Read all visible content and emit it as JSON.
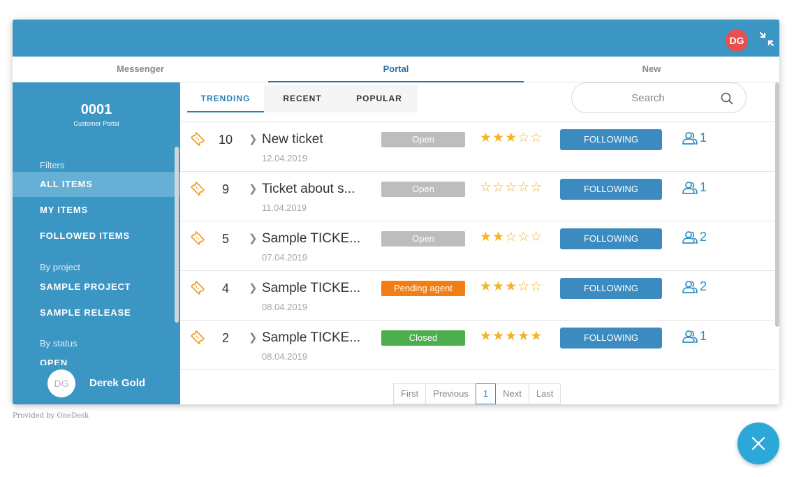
{
  "header": {
    "avatar_initials": "DG"
  },
  "tabs": [
    {
      "label": "Messenger",
      "active": false
    },
    {
      "label": "Portal",
      "active": true
    },
    {
      "label": "New",
      "active": false
    }
  ],
  "sidebar": {
    "portal_number": "0001",
    "portal_name": "Customer Portal",
    "filters_heading": "Filters",
    "items": [
      {
        "label": "ALL ITEMS",
        "active": true
      },
      {
        "label": "MY ITEMS",
        "active": false
      },
      {
        "label": "FOLLOWED ITEMS",
        "active": false
      }
    ],
    "by_project_heading": "By project",
    "projects": [
      "SAMPLE PROJECT",
      "SAMPLE RELEASE"
    ],
    "by_status_heading": "By status",
    "statuses": [
      "OPEN"
    ],
    "user": {
      "initials": "DG",
      "name": "Derek Gold"
    }
  },
  "subtabs": [
    {
      "label": "TRENDING",
      "active": true
    },
    {
      "label": "RECENT",
      "active": false
    },
    {
      "label": "POPULAR",
      "active": false
    }
  ],
  "search": {
    "placeholder": "Search"
  },
  "tickets": [
    {
      "number": "10",
      "title": "New ticket",
      "date": "12.04.2019",
      "status": "Open",
      "status_color": "#bdbdbd",
      "rating": 3,
      "follow_label": "FOLLOWING",
      "followers": "1"
    },
    {
      "number": "9",
      "title": "Ticket about s...",
      "date": "11.04.2019",
      "status": "Open",
      "status_color": "#bdbdbd",
      "rating": 0,
      "follow_label": "FOLLOWING",
      "followers": "1"
    },
    {
      "number": "5",
      "title": "Sample TICKE...",
      "date": "07.04.2019",
      "status": "Open",
      "status_color": "#bdbdbd",
      "rating": 2,
      "follow_label": "FOLLOWING",
      "followers": "2"
    },
    {
      "number": "4",
      "title": "Sample TICKE...",
      "date": "08.04.2019",
      "status": "Pending agent",
      "status_color": "#f07e12",
      "rating": 3,
      "follow_label": "FOLLOWING",
      "followers": "2"
    },
    {
      "number": "2",
      "title": "Sample TICKE...",
      "date": "08.04.2019",
      "status": "Closed",
      "status_color": "#4cae4c",
      "rating": 5,
      "follow_label": "FOLLOWING",
      "followers": "1"
    }
  ],
  "pagination": {
    "first": "First",
    "previous": "Previous",
    "current": "1",
    "next": "Next",
    "last": "Last"
  },
  "footer": {
    "provided_by": "Provided by OneDesk"
  },
  "colors": {
    "brand": "#3b96c4",
    "accent": "#2b7fb5",
    "star": "#f5b323",
    "fab": "#2ba7d8"
  }
}
